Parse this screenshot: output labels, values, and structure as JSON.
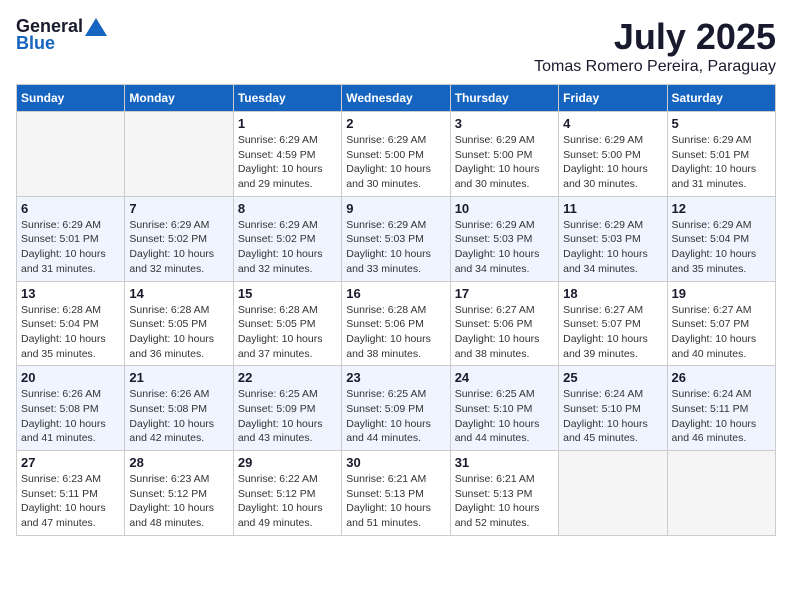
{
  "header": {
    "logo_general": "General",
    "logo_blue": "Blue",
    "title": "July 2025",
    "subtitle": "Tomas Romero Pereira, Paraguay"
  },
  "calendar": {
    "days_of_week": [
      "Sunday",
      "Monday",
      "Tuesday",
      "Wednesday",
      "Thursday",
      "Friday",
      "Saturday"
    ],
    "weeks": [
      [
        {
          "day": "",
          "empty": true
        },
        {
          "day": "",
          "empty": true
        },
        {
          "day": "1",
          "sunrise": "6:29 AM",
          "sunset": "4:59 PM",
          "daylight": "10 hours and 29 minutes."
        },
        {
          "day": "2",
          "sunrise": "6:29 AM",
          "sunset": "5:00 PM",
          "daylight": "10 hours and 30 minutes."
        },
        {
          "day": "3",
          "sunrise": "6:29 AM",
          "sunset": "5:00 PM",
          "daylight": "10 hours and 30 minutes."
        },
        {
          "day": "4",
          "sunrise": "6:29 AM",
          "sunset": "5:00 PM",
          "daylight": "10 hours and 30 minutes."
        },
        {
          "day": "5",
          "sunrise": "6:29 AM",
          "sunset": "5:01 PM",
          "daylight": "10 hours and 31 minutes."
        }
      ],
      [
        {
          "day": "6",
          "sunrise": "6:29 AM",
          "sunset": "5:01 PM",
          "daylight": "10 hours and 31 minutes."
        },
        {
          "day": "7",
          "sunrise": "6:29 AM",
          "sunset": "5:02 PM",
          "daylight": "10 hours and 32 minutes."
        },
        {
          "day": "8",
          "sunrise": "6:29 AM",
          "sunset": "5:02 PM",
          "daylight": "10 hours and 32 minutes."
        },
        {
          "day": "9",
          "sunrise": "6:29 AM",
          "sunset": "5:03 PM",
          "daylight": "10 hours and 33 minutes."
        },
        {
          "day": "10",
          "sunrise": "6:29 AM",
          "sunset": "5:03 PM",
          "daylight": "10 hours and 34 minutes."
        },
        {
          "day": "11",
          "sunrise": "6:29 AM",
          "sunset": "5:03 PM",
          "daylight": "10 hours and 34 minutes."
        },
        {
          "day": "12",
          "sunrise": "6:29 AM",
          "sunset": "5:04 PM",
          "daylight": "10 hours and 35 minutes."
        }
      ],
      [
        {
          "day": "13",
          "sunrise": "6:28 AM",
          "sunset": "5:04 PM",
          "daylight": "10 hours and 35 minutes."
        },
        {
          "day": "14",
          "sunrise": "6:28 AM",
          "sunset": "5:05 PM",
          "daylight": "10 hours and 36 minutes."
        },
        {
          "day": "15",
          "sunrise": "6:28 AM",
          "sunset": "5:05 PM",
          "daylight": "10 hours and 37 minutes."
        },
        {
          "day": "16",
          "sunrise": "6:28 AM",
          "sunset": "5:06 PM",
          "daylight": "10 hours and 38 minutes."
        },
        {
          "day": "17",
          "sunrise": "6:27 AM",
          "sunset": "5:06 PM",
          "daylight": "10 hours and 38 minutes."
        },
        {
          "day": "18",
          "sunrise": "6:27 AM",
          "sunset": "5:07 PM",
          "daylight": "10 hours and 39 minutes."
        },
        {
          "day": "19",
          "sunrise": "6:27 AM",
          "sunset": "5:07 PM",
          "daylight": "10 hours and 40 minutes."
        }
      ],
      [
        {
          "day": "20",
          "sunrise": "6:26 AM",
          "sunset": "5:08 PM",
          "daylight": "10 hours and 41 minutes."
        },
        {
          "day": "21",
          "sunrise": "6:26 AM",
          "sunset": "5:08 PM",
          "daylight": "10 hours and 42 minutes."
        },
        {
          "day": "22",
          "sunrise": "6:25 AM",
          "sunset": "5:09 PM",
          "daylight": "10 hours and 43 minutes."
        },
        {
          "day": "23",
          "sunrise": "6:25 AM",
          "sunset": "5:09 PM",
          "daylight": "10 hours and 44 minutes."
        },
        {
          "day": "24",
          "sunrise": "6:25 AM",
          "sunset": "5:10 PM",
          "daylight": "10 hours and 44 minutes."
        },
        {
          "day": "25",
          "sunrise": "6:24 AM",
          "sunset": "5:10 PM",
          "daylight": "10 hours and 45 minutes."
        },
        {
          "day": "26",
          "sunrise": "6:24 AM",
          "sunset": "5:11 PM",
          "daylight": "10 hours and 46 minutes."
        }
      ],
      [
        {
          "day": "27",
          "sunrise": "6:23 AM",
          "sunset": "5:11 PM",
          "daylight": "10 hours and 47 minutes."
        },
        {
          "day": "28",
          "sunrise": "6:23 AM",
          "sunset": "5:12 PM",
          "daylight": "10 hours and 48 minutes."
        },
        {
          "day": "29",
          "sunrise": "6:22 AM",
          "sunset": "5:12 PM",
          "daylight": "10 hours and 49 minutes."
        },
        {
          "day": "30",
          "sunrise": "6:21 AM",
          "sunset": "5:13 PM",
          "daylight": "10 hours and 51 minutes."
        },
        {
          "day": "31",
          "sunrise": "6:21 AM",
          "sunset": "5:13 PM",
          "daylight": "10 hours and 52 minutes."
        },
        {
          "day": "",
          "empty": true
        },
        {
          "day": "",
          "empty": true
        }
      ]
    ]
  }
}
